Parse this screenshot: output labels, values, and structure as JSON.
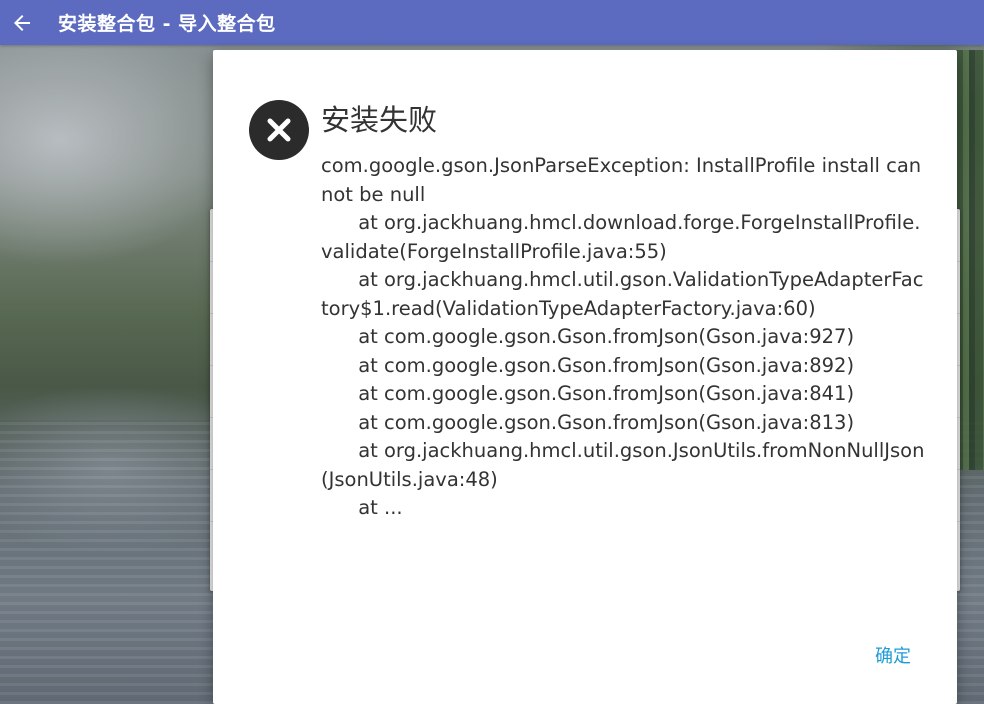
{
  "appbar": {
    "title": "安装整合包 - 导入整合包",
    "back_icon": "arrow-left-icon",
    "color": "#5c6bc0"
  },
  "dialog": {
    "icon": "error-x-icon",
    "title": "安装失败",
    "message": "com.google.gson.JsonParseException: InstallProfile install cannot be null\n\tat org.jackhuang.hmcl.download.forge.ForgeInstallProfile.validate(ForgeInstallProfile.java:55)\n\tat org.jackhuang.hmcl.util.gson.ValidationTypeAdapterFactory$1.read(ValidationTypeAdapterFactory.java:60)\n\tat com.google.gson.Gson.fromJson(Gson.java:927)\n\tat com.google.gson.Gson.fromJson(Gson.java:892)\n\tat com.google.gson.Gson.fromJson(Gson.java:841)\n\tat com.google.gson.Gson.fromJson(Gson.java:813)\n\tat org.jackhuang.hmcl.util.gson.JsonUtils.fromNonNullJson(JsonUtils.java:48)\n\tat ...",
    "confirm_label": "确定",
    "accent_color": "#1e9bd7"
  }
}
